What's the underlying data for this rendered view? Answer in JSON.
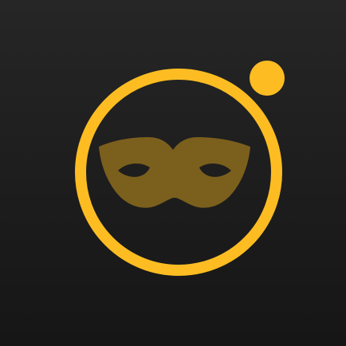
{
  "icon": {
    "background": "#1e1e1e",
    "accent": "#fdbd22",
    "mask_color": "#7b5f1c",
    "symbols": [
      "ring-lens",
      "masquerade-mask",
      "status-dot"
    ]
  }
}
